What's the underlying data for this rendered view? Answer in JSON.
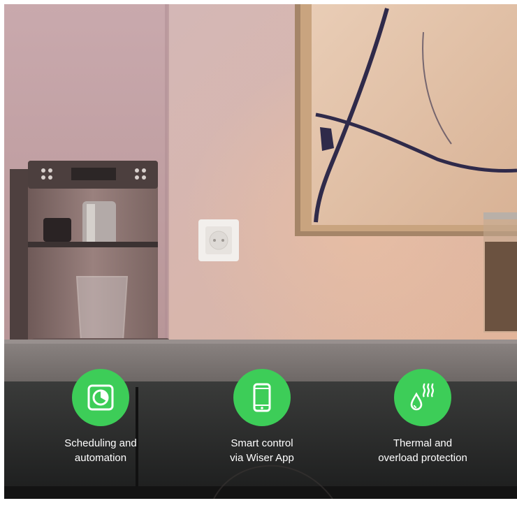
{
  "features": [
    {
      "icon": "timer-icon",
      "line1": "Scheduling and",
      "line2": "automation"
    },
    {
      "icon": "smartphone-icon",
      "line1": "Smart control",
      "line2": "via Wiser App"
    },
    {
      "icon": "heat-drop-icon",
      "line1": "Thermal and",
      "line2": "overload protection"
    }
  ],
  "colors": {
    "badge": "#3dcd58",
    "caption": "#ffffff"
  }
}
